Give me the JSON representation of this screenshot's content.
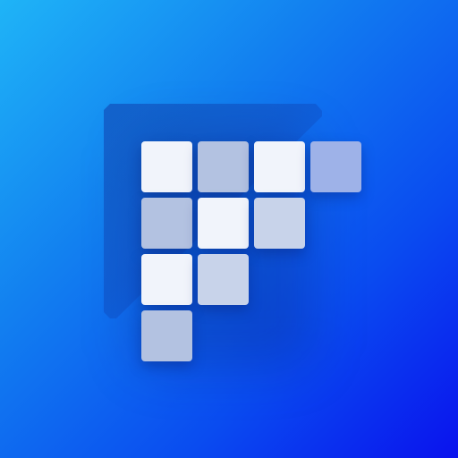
{
  "logo": {
    "icon": "grid-f-logo-icon",
    "colors": {
      "background_start": "#1fb4f7",
      "background_end": "#0a12ee",
      "tile_bright": "#f1f4fb",
      "tile_light": "#c8d3ea",
      "tile_mid": "#b3c2e1",
      "tile_dim": "#9eb2e8"
    },
    "tiles": [
      {
        "row": 0,
        "col": 0,
        "shade": "bright"
      },
      {
        "row": 0,
        "col": 1,
        "shade": "mid"
      },
      {
        "row": 0,
        "col": 2,
        "shade": "bright"
      },
      {
        "row": 0,
        "col": 3,
        "shade": "dim"
      },
      {
        "row": 1,
        "col": 0,
        "shade": "mid"
      },
      {
        "row": 1,
        "col": 1,
        "shade": "bright"
      },
      {
        "row": 1,
        "col": 2,
        "shade": "light"
      },
      {
        "row": 2,
        "col": 0,
        "shade": "bright"
      },
      {
        "row": 2,
        "col": 1,
        "shade": "light"
      },
      {
        "row": 3,
        "col": 0,
        "shade": "mid"
      }
    ]
  }
}
